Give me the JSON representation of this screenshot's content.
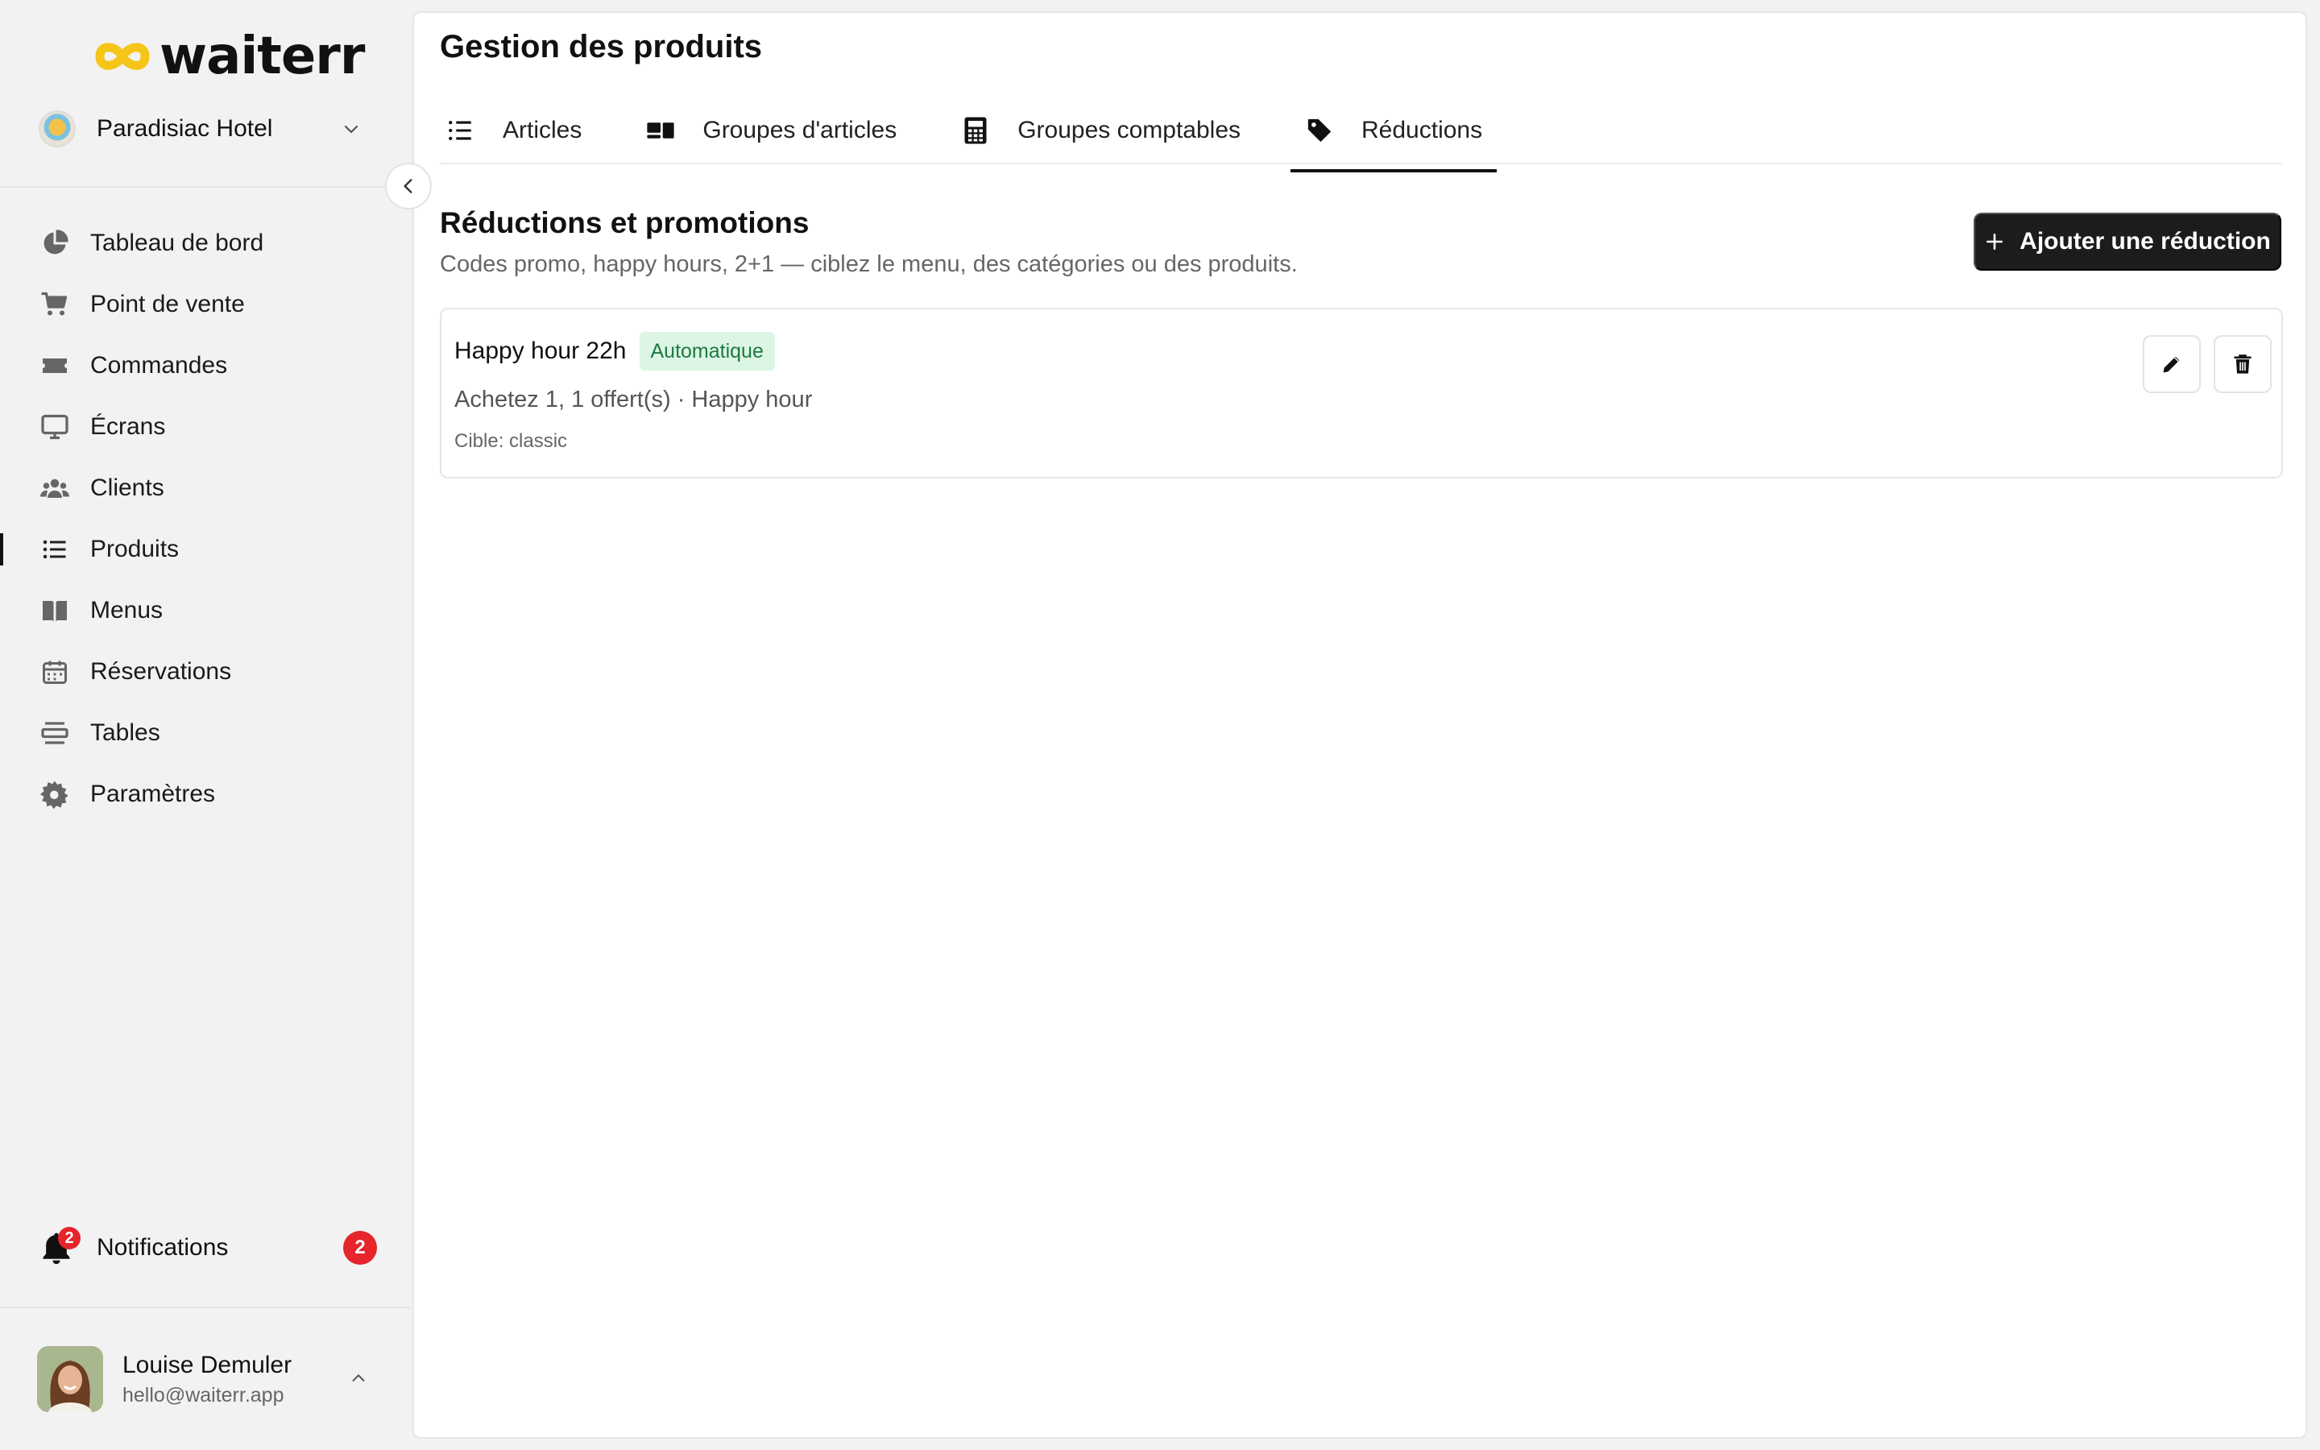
{
  "brand": {
    "name": "waiterr",
    "accent": "#f5c518"
  },
  "venue": {
    "name": "Paradisiac Hotel"
  },
  "nav": {
    "items": [
      {
        "label": "Tableau de bord",
        "icon": "pie-chart-icon"
      },
      {
        "label": "Point de vente",
        "icon": "cart-icon"
      },
      {
        "label": "Commandes",
        "icon": "ticket-icon"
      },
      {
        "label": "Écrans",
        "icon": "monitor-icon"
      },
      {
        "label": "Clients",
        "icon": "users-icon"
      },
      {
        "label": "Produits",
        "icon": "list-icon",
        "active": true
      },
      {
        "label": "Menus",
        "icon": "book-icon"
      },
      {
        "label": "Réservations",
        "icon": "calendar-icon"
      },
      {
        "label": "Tables",
        "icon": "table-icon"
      },
      {
        "label": "Paramètres",
        "icon": "gear-icon"
      }
    ]
  },
  "notifications": {
    "label": "Notifications",
    "count": "2"
  },
  "user": {
    "name": "Louise Demuler",
    "email": "hello@waiterr.app"
  },
  "page": {
    "title": "Gestion des produits",
    "tabs": [
      {
        "label": "Articles",
        "icon": "list-icon"
      },
      {
        "label": "Groupes d'articles",
        "icon": "groups-icon"
      },
      {
        "label": "Groupes comptables",
        "icon": "calculator-icon"
      },
      {
        "label": "Réductions",
        "icon": "tag-icon",
        "active": true
      }
    ]
  },
  "section": {
    "title": "Réductions et promotions",
    "subtitle": "Codes promo, happy hours, 2+1 — ciblez le menu, des catégories ou des produits.",
    "add_button": "Ajouter une réduction"
  },
  "discounts": [
    {
      "name": "Happy hour 22h",
      "badge": "Automatique",
      "description": "Achetez 1, 1 offert(s) · Happy hour",
      "target": "Cible: classic"
    }
  ],
  "colors": {
    "badge_bg": "#dcf5e4",
    "badge_text": "#1d7a3e",
    "danger": "#e5242b",
    "primary_button": "#1c1c1c"
  }
}
